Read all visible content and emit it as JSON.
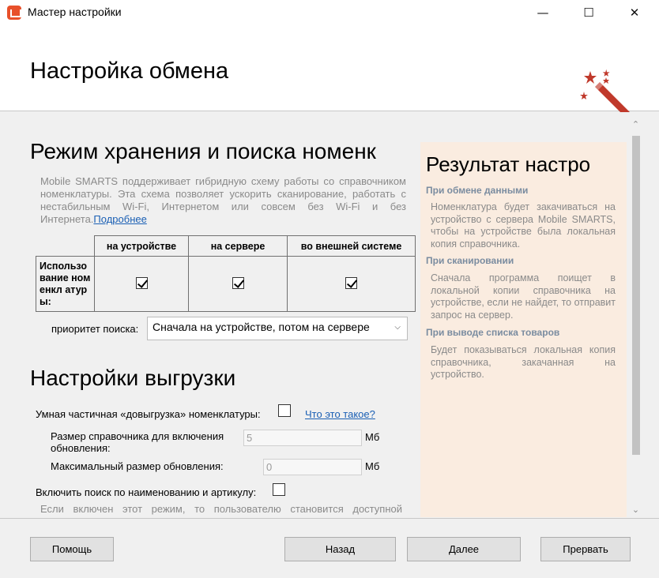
{
  "window": {
    "title": "Мастер настройки",
    "minimize": "—",
    "maximize": "☐",
    "close": "✕"
  },
  "header": {
    "title": "Настройка обмена",
    "wand_color": "#c0392b"
  },
  "storage": {
    "heading": "Режим хранения и поиска номенк",
    "description": "Mobile SMARTS поддерживает гибридную схему работы со справочником номенклатуры. Эта схема позволяет ускорить сканирование, работать с нестабильным Wi-Fi, Интернетом или совсем без Wi-Fi и без Интернета.",
    "more_link": "Подробнее",
    "table": {
      "columns": [
        "на устройстве",
        "на сервере",
        "во внешней системе"
      ],
      "row_label": "Использо вание номенкл атуры:",
      "checked": [
        true,
        true,
        true
      ]
    },
    "priority_label": "приоритет поиска:",
    "priority_value": "Сначала на устройстве, потом на сервере"
  },
  "upload": {
    "heading": "Настройки выгрузки",
    "smart_label": "Умная частичная «довыгрузка» номенклатуры:",
    "smart_checked": false,
    "what_link": "Что это такое?",
    "size_label": "Размер справочника для включения обновления:",
    "size_value": "5",
    "size_unit": "Мб",
    "max_label": "Максимальный размер обновления:",
    "max_value": "0",
    "max_unit": "Мб",
    "search_label": "Включить поиск по наименованию и артикулу:",
    "search_checked": false,
    "hint": "Если включен этот режим, то пользователю становится доступной"
  },
  "result": {
    "title": "Результат настро",
    "sections": [
      {
        "heading": "При обмене данными",
        "text": "Номенклатура будет закачиваться на устройство с сервера Mobile SMARTS, чтобы на устройстве была локальная копия справочника."
      },
      {
        "heading": "При сканировании",
        "text": "Сначала программа поищет в локальной копии справочника на устройстве, если не найдет, то отправит запрос на сервер."
      },
      {
        "heading": "При выводе списка товаров",
        "text": "Будет показываться локальная копия справочника, закачанная на устройство."
      }
    ]
  },
  "footer": {
    "help": "Помощь",
    "back": "Назад",
    "next": "Далее",
    "cancel": "Прервать"
  }
}
